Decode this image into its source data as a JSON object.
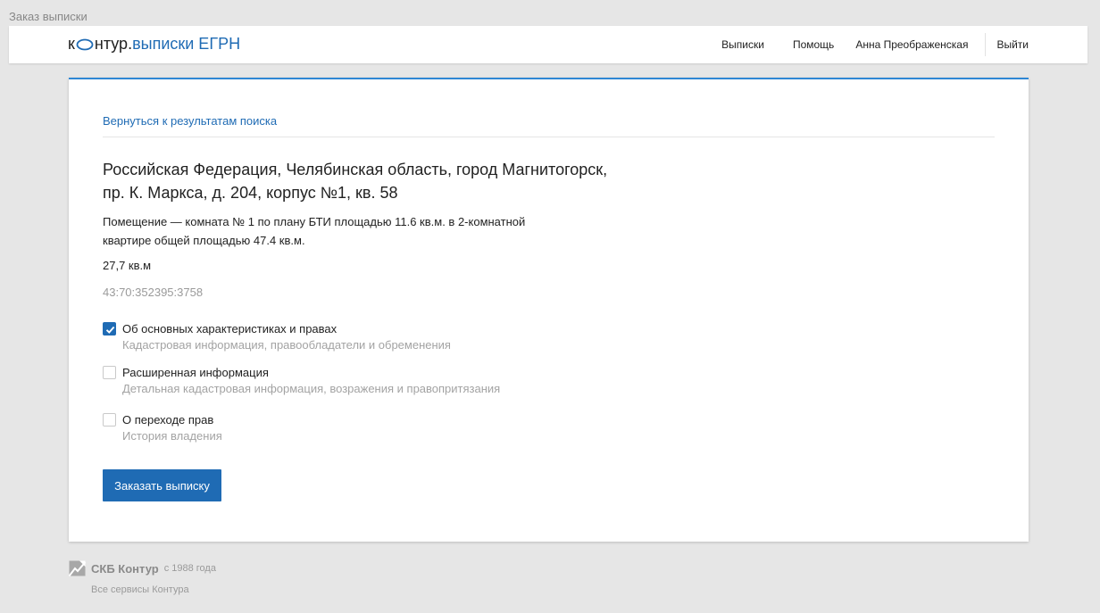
{
  "window": {
    "title": "Заказ выписки"
  },
  "header": {
    "logo": {
      "prefix": "к",
      "suffix": "нтур.",
      "product": "выписки ЕГРН"
    },
    "nav": {
      "statements": "Выписки",
      "help": "Помощь",
      "user": "Анна Преображенская",
      "logout": "Выйти"
    }
  },
  "main": {
    "back_link": "Вернуться к результатам поиска",
    "address_line1": "Российская Федерация, Челябинская область, город Магнитогорск,",
    "address_line2": "пр. К. Маркса, д. 204, корпус №1, кв. 58",
    "description_line1": "Помещение — комната № 1 по плану БТИ площадью 11.6 кв.м. в 2-комнатной",
    "description_line2": "квартире общей площадью 47.4 кв.м.",
    "area": "27,7 кв.м",
    "cadastral_number": "43:70:352395:3758",
    "options": [
      {
        "title": "Об основных характеристиках и правах",
        "subtitle": "Кадастровая информация, правообладатели и обременения",
        "checked": true
      },
      {
        "title": "Расширенная информация",
        "subtitle": "Детальная кадастровая информация, возражения и правопритязания",
        "checked": false
      },
      {
        "title": "О переходе прав",
        "subtitle": "История владения",
        "checked": false
      }
    ],
    "order_button": "Заказать выписку"
  },
  "footer": {
    "brand": "СКБ Контур",
    "since": "с 1988 года",
    "all_services": "Все сервисы Контура"
  },
  "colors": {
    "accent": "#1f6bb4",
    "card_top_border": "#2e87d4",
    "background": "#e6e6e6"
  },
  "icons": {
    "logo_o": "contour-o-icon",
    "checkmark": "check-icon",
    "footer_logo": "skb-kontur-logo-icon"
  }
}
